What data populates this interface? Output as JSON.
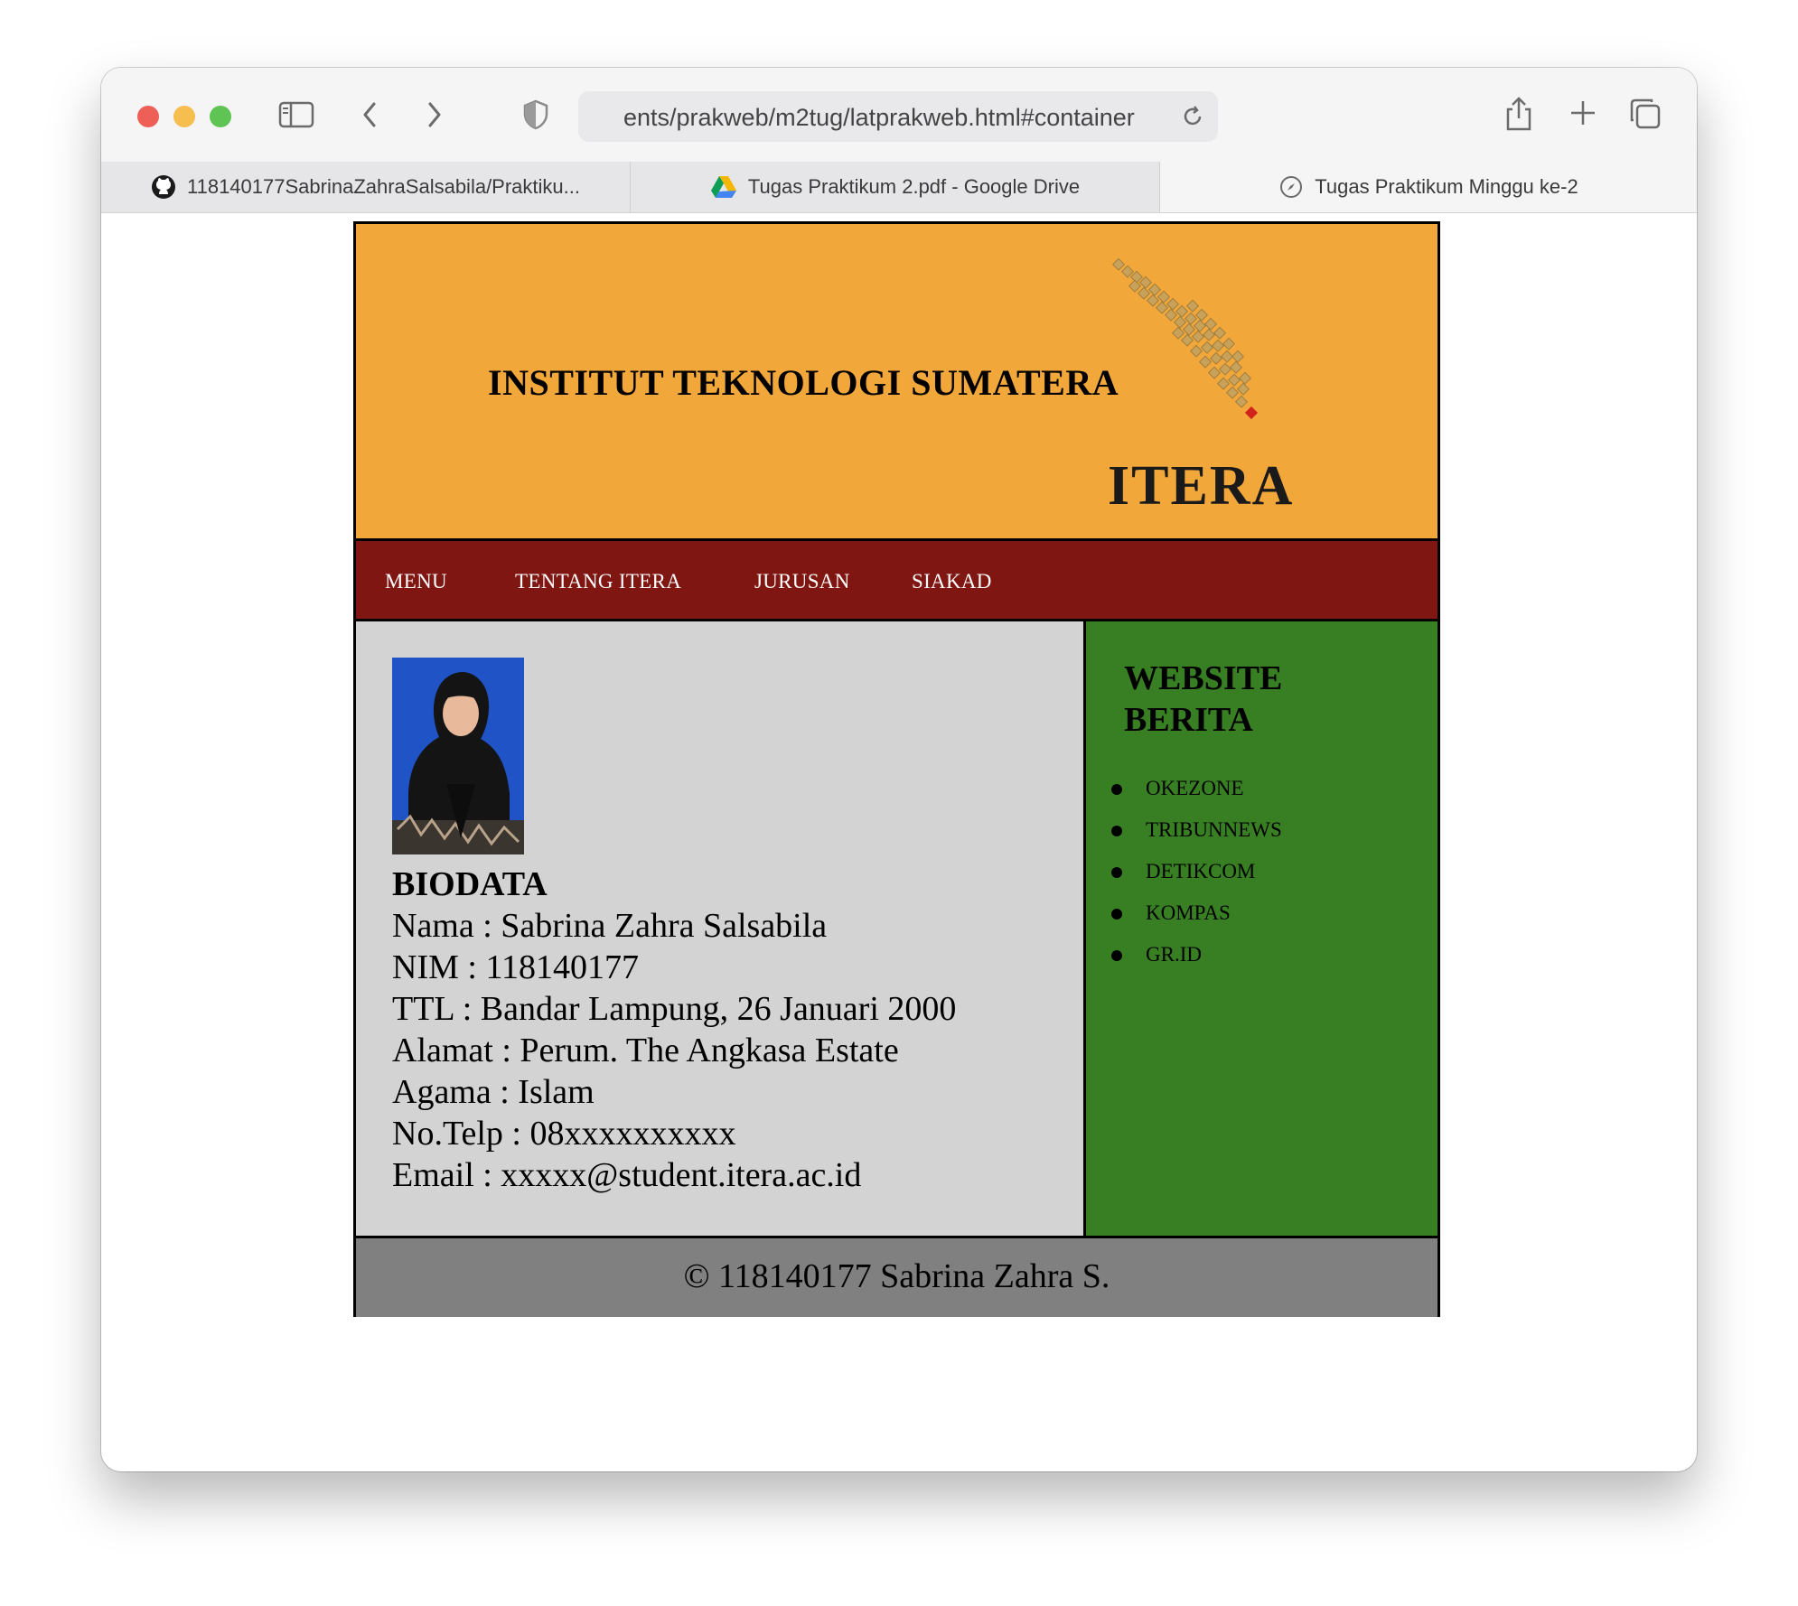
{
  "browser": {
    "url": "ents/prakweb/m2tug/latprakweb.html#container",
    "tabs": [
      {
        "label": "118140177SabrinaZahraSalsabila/Praktiku...",
        "icon": "github-icon"
      },
      {
        "label": "Tugas Praktikum 2.pdf - Google Drive",
        "icon": "google-drive-icon"
      },
      {
        "label": "Tugas Praktikum Minggu ke-2",
        "icon": "compass-icon"
      }
    ]
  },
  "header": {
    "title": "INSTITUT TEKNOLOGI SUMATERA",
    "logo_text": "ITERA"
  },
  "nav": {
    "items": [
      "MENU",
      "TENTANG ITERA",
      "JURUSAN",
      "SIAKAD"
    ]
  },
  "biodata": {
    "heading": "BIODATA",
    "lines": [
      "Nama : Sabrina Zahra Salsabila",
      "NIM : 118140177",
      "TTL : Bandar Lampung, 26 Januari 2000",
      "Alamat : Perum. The Angkasa Estate",
      "Agama : Islam",
      "No.Telp : 08xxxxxxxxxx",
      "Email : xxxxx@student.itera.ac.id"
    ]
  },
  "sidebar": {
    "title_line1": "WEBSITE",
    "title_line2": "BERITA",
    "links": [
      "OKEZONE",
      "TRIBUNNEWS",
      "DETIKCOM",
      "KOMPAS",
      "GR.ID"
    ]
  },
  "footer": {
    "text": "© 118140177 Sabrina Zahra S."
  },
  "colors": {
    "header_bg": "#f2a73b",
    "nav_bg": "#7f1611",
    "content_bg": "#d3d3d3",
    "sidebar_bg": "#387f23",
    "footer_bg": "#808080"
  }
}
